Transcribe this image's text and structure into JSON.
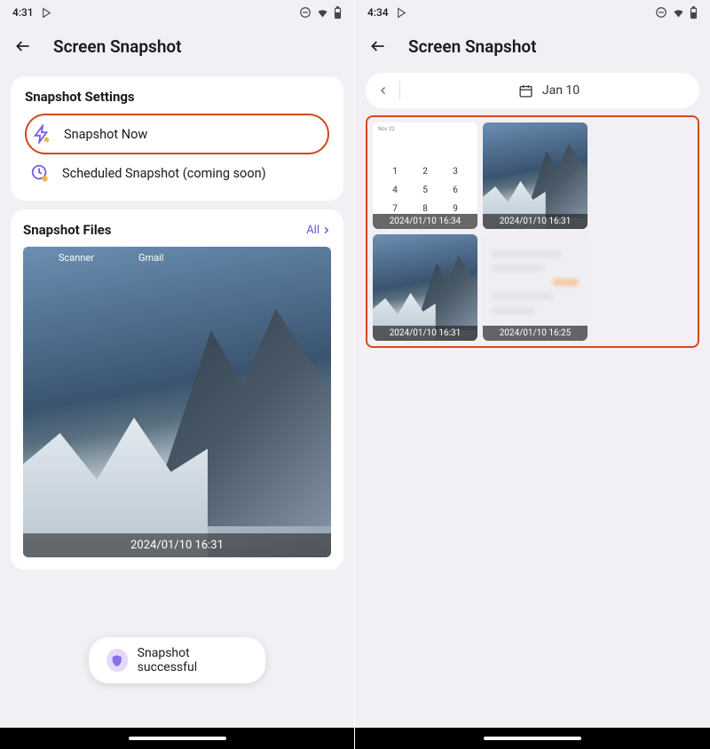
{
  "left": {
    "status": {
      "time": "4:31"
    },
    "header": {
      "title": "Screen Snapshot"
    },
    "settings": {
      "title": "Snapshot Settings",
      "snapshot_now": "Snapshot Now",
      "scheduled": "Scheduled Snapshot (coming soon)"
    },
    "files": {
      "title": "Snapshot Files",
      "all": "All",
      "thumb_caption": "2024/01/10 16:31",
      "label_scanner": "Scanner",
      "label_gmail": "Gmail"
    },
    "toast": {
      "text": "Snapshot successful"
    }
  },
  "right": {
    "status": {
      "time": "4:34"
    },
    "header": {
      "title": "Screen Snapshot"
    },
    "datenav": {
      "date": "Jan 10"
    },
    "thumbs": [
      {
        "caption": "2024/01/10 16:34"
      },
      {
        "caption": "2024/01/10 16:31"
      },
      {
        "caption": "2024/01/10 16:31"
      },
      {
        "caption": "2024/01/10 16:25"
      }
    ]
  }
}
